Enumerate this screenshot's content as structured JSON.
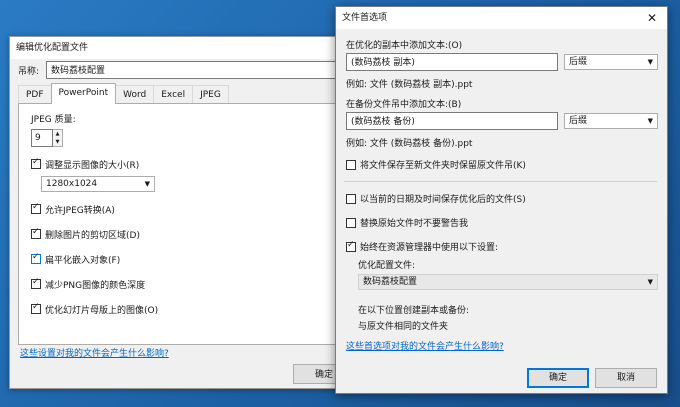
{
  "back_window": {
    "title": "编辑优化配置文件",
    "name_label": "吊称:",
    "name_value": "数码荔枝配置",
    "tabs": [
      "PDF",
      "PowerPoint",
      "Word",
      "Excel",
      "JPEG"
    ],
    "active_tab": "PowerPoint",
    "jpeg_quality_label": "JPEG 质量:",
    "jpeg_quality_value": "9",
    "resize_label": "调整显示图像的大小(R)",
    "resolution_value": "1280x1024",
    "allow_jpeg_label": "允许JPEG转换(A)",
    "delete_crop_label": "删除图片的剪切区域(D)",
    "flatten_label": "扁平化嵌入对象(F)",
    "reduce_png_label": "减少PNG图像的颜色深度",
    "optimize_master_label": "优化幻灯片母版上的图像(O)",
    "help_link": "这些设置对我的文件会产生什么影响?",
    "ok_label": "确定"
  },
  "dialog": {
    "title": "文件首选项",
    "close_icon": "close-icon",
    "copy_label": "在优化的副本中添加文本:(O)",
    "copy_text_value": "(数码荔枝 副本)",
    "copy_position_value": "后缀",
    "copy_example": "例如:  文件 (数码荔枝 副本).ppt",
    "backup_label": "在备份文件吊中添加文本:(B)",
    "backup_text_value": "(数码荔枝 备份)",
    "backup_position_value": "后缀",
    "backup_example": "例如:  文件 (数码荔枝 备份).ppt",
    "keep_original_label": "将文件保存至新文件夹时保留原文件吊(K)",
    "date_label": "以当前的日期及时间保存优化后的文件(S)",
    "no_warn_label": "替换原始文件时不要警告我",
    "always_use_label": "始终在资源管理器中使用以下设置:",
    "profile_label": "优化配置文件:",
    "profile_value": "数码荔枝配置",
    "location_label": "在以下位置创建副本或备份:",
    "location_value": "与原文件相同的文件夹",
    "help_link": "这些首选项对我的文件会产生什么影响?",
    "ok_label": "确定",
    "cancel_label": "取消"
  }
}
